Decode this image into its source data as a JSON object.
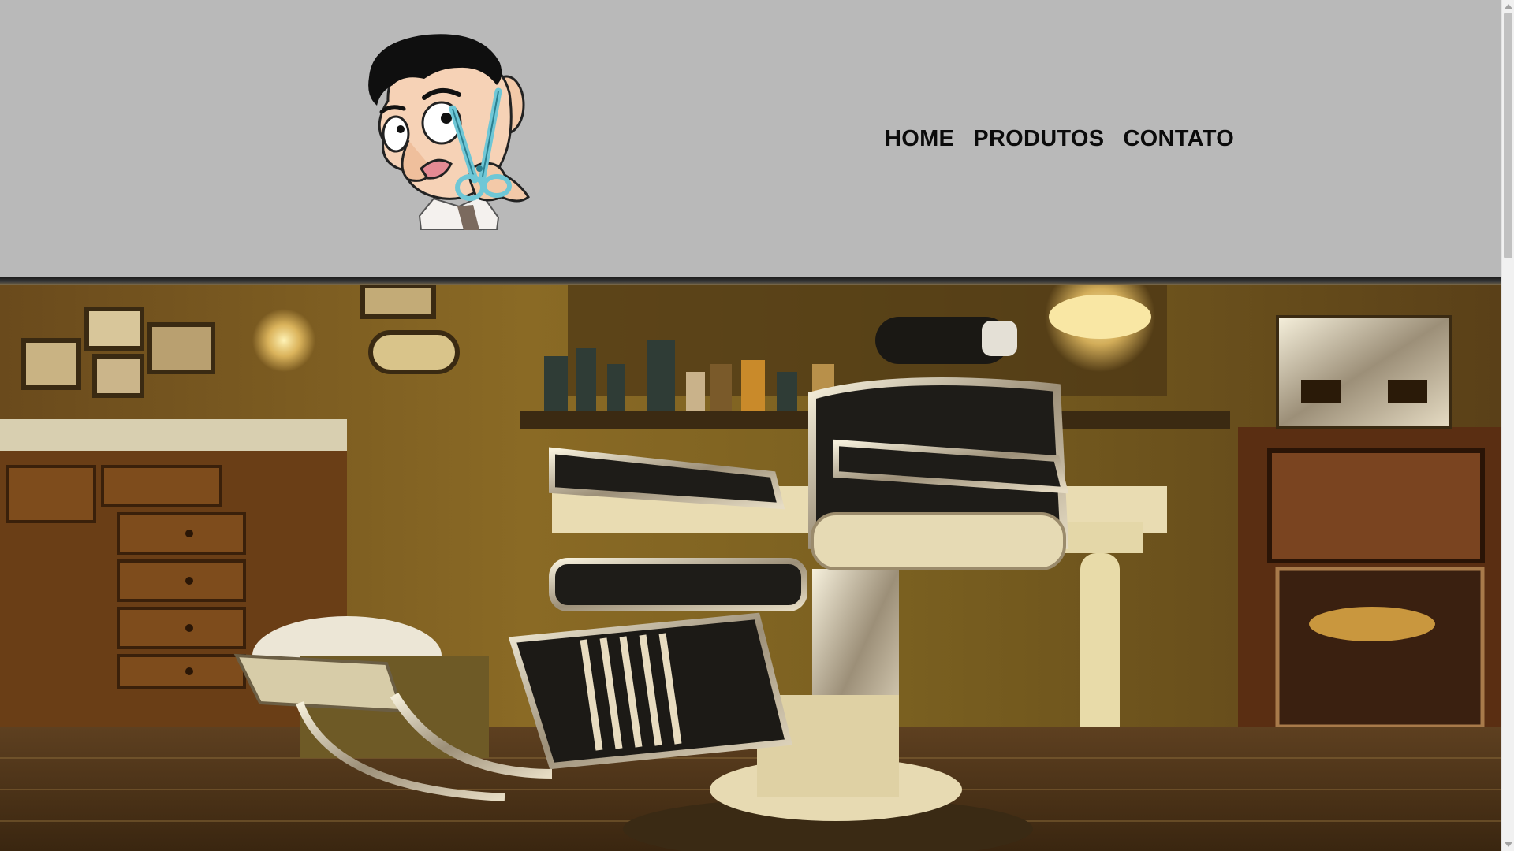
{
  "header": {
    "logo": {
      "icon": "barber-cartoon-scissors-logo"
    },
    "nav": [
      {
        "label": "HOME"
      },
      {
        "label": "PRODUTOS"
      },
      {
        "label": "CONTATO"
      }
    ],
    "background_color": "#b9b9b9"
  },
  "hero": {
    "image": "vintage-barber-shop-chair-photo"
  },
  "scrollbar": {
    "up_icon": "arrow-up-icon",
    "down_icon": "arrow-down-icon"
  }
}
